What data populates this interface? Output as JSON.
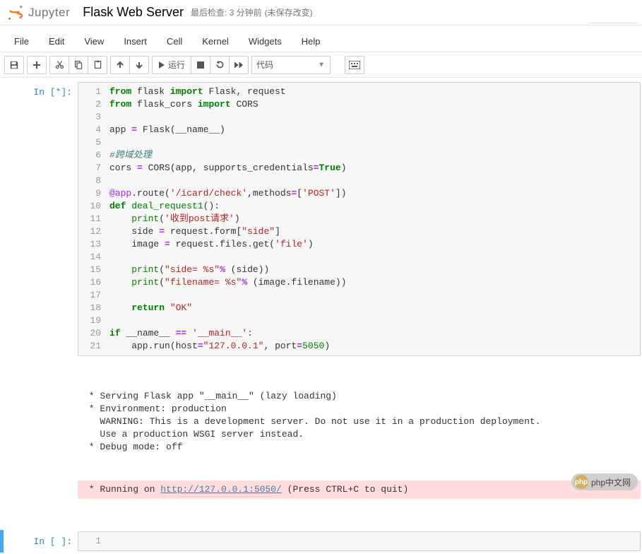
{
  "header": {
    "logo_text": "Jupyter",
    "title": "Flask Web Server",
    "checkpoint": "最后检查: 3 分钟前",
    "autosave": "(未保存改变)"
  },
  "menubar": [
    "File",
    "Edit",
    "View",
    "Insert",
    "Cell",
    "Kernel",
    "Widgets",
    "Help"
  ],
  "toolbar": {
    "run_label": "运行",
    "cell_type": "代码"
  },
  "cells": [
    {
      "prompt": "In [*]:",
      "line_numbers": [
        "1",
        "2",
        "3",
        "4",
        "5",
        "6",
        "7",
        "8",
        "9",
        "10",
        "11",
        "12",
        "13",
        "14",
        "15",
        "16",
        "17",
        "18",
        "19",
        "20",
        "21"
      ],
      "code_tokens": [
        [
          [
            "kw",
            "from"
          ],
          [
            "",
            " flask "
          ],
          [
            "kw",
            "import"
          ],
          [
            "",
            " Flask, request"
          ]
        ],
        [
          [
            "kw",
            "from"
          ],
          [
            "",
            " flask_cors "
          ],
          [
            "kw",
            "import"
          ],
          [
            "",
            " CORS"
          ]
        ],
        [
          [
            "",
            ""
          ]
        ],
        [
          [
            "",
            "app "
          ],
          [
            "op",
            "="
          ],
          [
            "",
            " Flask(__name__)"
          ]
        ],
        [
          [
            "",
            ""
          ]
        ],
        [
          [
            "cmt",
            "#跨域处理"
          ]
        ],
        [
          [
            "",
            "cors "
          ],
          [
            "op",
            "="
          ],
          [
            "",
            " CORS(app, supports_credentials"
          ],
          [
            "op",
            "="
          ],
          [
            "bool",
            "True"
          ],
          [
            "",
            ")"
          ]
        ],
        [
          [
            "",
            ""
          ]
        ],
        [
          [
            "dec",
            "@app"
          ],
          [
            "",
            ".route("
          ],
          [
            "str",
            "'/icard/check'"
          ],
          [
            "",
            ",methods"
          ],
          [
            "op",
            "="
          ],
          [
            "",
            "["
          ],
          [
            "str",
            "'POST'"
          ],
          [
            "",
            "])"
          ]
        ],
        [
          [
            "kw",
            "def"
          ],
          [
            "",
            " "
          ],
          [
            "builtin",
            "deal_request1"
          ],
          [
            "",
            "():"
          ]
        ],
        [
          [
            "",
            "    "
          ],
          [
            "builtin",
            "print"
          ],
          [
            "",
            "("
          ],
          [
            "str",
            "'收到post请求'"
          ],
          [
            "",
            ")"
          ]
        ],
        [
          [
            "",
            "    side "
          ],
          [
            "op",
            "="
          ],
          [
            "",
            " request.form["
          ],
          [
            "str",
            "\"side\""
          ],
          [
            "",
            "]"
          ]
        ],
        [
          [
            "",
            "    image "
          ],
          [
            "op",
            "="
          ],
          [
            "",
            " request.files.get("
          ],
          [
            "str",
            "'file'"
          ],
          [
            "",
            ")"
          ]
        ],
        [
          [
            "",
            ""
          ]
        ],
        [
          [
            "",
            "    "
          ],
          [
            "builtin",
            "print"
          ],
          [
            "",
            "("
          ],
          [
            "str",
            "\"side= %s\""
          ],
          [
            "op",
            "%"
          ],
          [
            "",
            " (side))"
          ]
        ],
        [
          [
            "",
            "    "
          ],
          [
            "builtin",
            "print"
          ],
          [
            "",
            "("
          ],
          [
            "str",
            "\"filename= %s\""
          ],
          [
            "op",
            "%"
          ],
          [
            "",
            " (image.filename))"
          ]
        ],
        [
          [
            "",
            ""
          ]
        ],
        [
          [
            "",
            "    "
          ],
          [
            "kw",
            "return"
          ],
          [
            "",
            " "
          ],
          [
            "str",
            "\"OK\""
          ]
        ],
        [
          [
            "",
            ""
          ]
        ],
        [
          [
            "kw",
            "if"
          ],
          [
            "",
            " __name__ "
          ],
          [
            "op",
            "=="
          ],
          [
            "",
            " "
          ],
          [
            "str",
            "'__main__'"
          ],
          [
            "",
            ":"
          ]
        ],
        [
          [
            "",
            "    app.run(host"
          ],
          [
            "op",
            "="
          ],
          [
            "str",
            "\"127.0.0.1\""
          ],
          [
            "",
            ", port"
          ],
          [
            "op",
            "="
          ],
          [
            "num",
            "5050"
          ],
          [
            "",
            ")"
          ]
        ]
      ],
      "output_plain": [
        " * Serving Flask app \"__main__\" (lazy loading)",
        " * Environment: production",
        "   WARNING: This is a development server. Do not use it in a production deployment.",
        "   Use a production WSGI server instead.",
        " * Debug mode: off"
      ],
      "output_highlight_prefix": " * Running on ",
      "output_highlight_link": "http://127.0.0.1:5050/",
      "output_highlight_suffix": " (Press CTRL+C to quit)"
    },
    {
      "prompt": "In [ ]:",
      "line_numbers": [
        "1"
      ],
      "code_tokens": [
        [
          [
            "",
            ""
          ]
        ]
      ]
    }
  ],
  "watermark": {
    "logo": "php",
    "text": "php中文网"
  }
}
